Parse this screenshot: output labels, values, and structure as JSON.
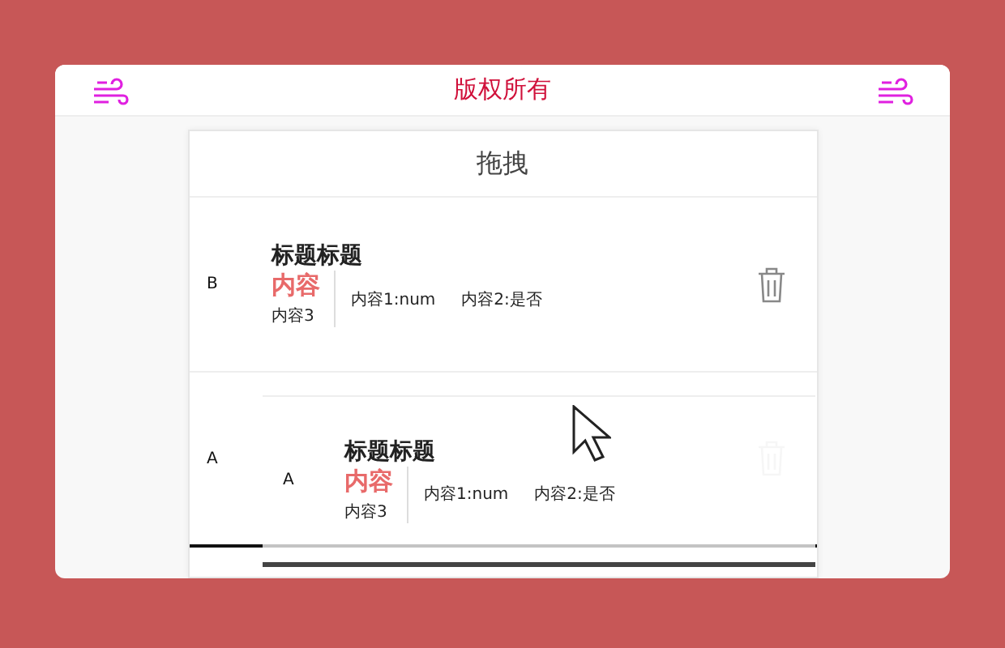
{
  "header": {
    "title": "版权所有"
  },
  "panel": {
    "title": "拖拽"
  },
  "rows": [
    {
      "letter": "B",
      "title": "标题标题",
      "highlight": "内容",
      "note": "内容3",
      "field_1": "内容1:num",
      "field_2": "内容2:是否",
      "kind": "normal"
    },
    {
      "letter": "A",
      "kind": "placeholder"
    }
  ],
  "dragged_row": {
    "letter": "A",
    "title": "标题标题",
    "highlight": "内容",
    "note": "内容3",
    "field_1": "内容1:num",
    "field_2": "内容2:是否"
  }
}
